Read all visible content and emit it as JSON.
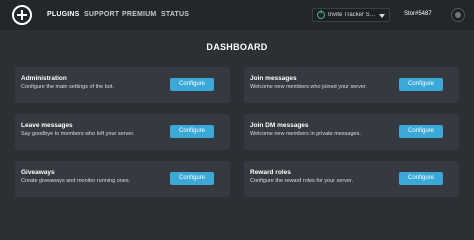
{
  "nav": {
    "links": [
      "PLUGINS",
      "SUPPORT",
      "PREMIUM",
      "STATUS"
    ],
    "server": {
      "name": "Invite Tracker Su...",
      "icon": "plus-circle-icon"
    },
    "username": "Stor#5487"
  },
  "page": {
    "title": "DASHBOARD"
  },
  "cards": [
    {
      "title": "Administration",
      "description": "Configure the main settings of the bot.",
      "button": "Configure"
    },
    {
      "title": "Join messages",
      "description": "Welcome new members who joined your server.",
      "button": "Configure"
    },
    {
      "title": "Leave messages",
      "description": "Say goodbye to members who left your server.",
      "button": "Configure"
    },
    {
      "title": "Join DM messages",
      "description": "Welcome new members in private messages.",
      "button": "Configure"
    },
    {
      "title": "Giveaways",
      "description": "Create giveaways and monitor running ones.",
      "button": "Configure"
    },
    {
      "title": "Reward roles",
      "description": "Configure the reward roles for your server.",
      "button": "Configure"
    }
  ],
  "colors": {
    "background": "#2c2f33",
    "navbar": "#23272a",
    "card": "#36393f",
    "accent": "#3ba9d8"
  }
}
